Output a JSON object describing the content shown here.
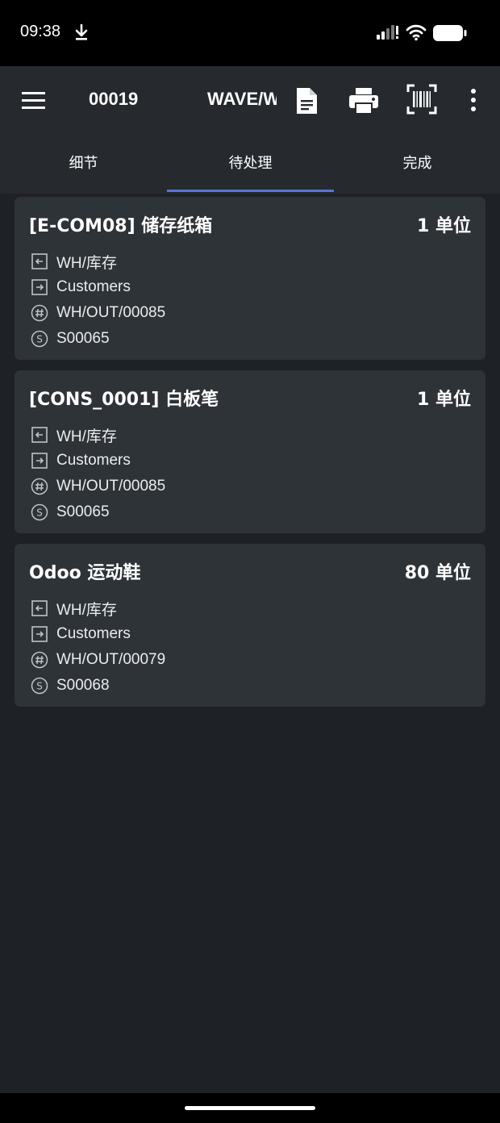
{
  "status": {
    "time": "09:38"
  },
  "header": {
    "title_id": "00019",
    "title_wave": "WAVE/W"
  },
  "tabs": [
    {
      "label": "细节"
    },
    {
      "label": "待处理"
    },
    {
      "label": "完成"
    }
  ],
  "active_tab": 1,
  "accent_color": "#5b75d6",
  "items": [
    {
      "name": "[E-COM08] 储存纸箱",
      "qty": "1 单位",
      "from": "WH/库存",
      "to": "Customers",
      "ref": "WH/OUT/00085",
      "origin": "S00065"
    },
    {
      "name": "[CONS_0001] 白板笔",
      "qty": "1 单位",
      "from": "WH/库存",
      "to": "Customers",
      "ref": "WH/OUT/00085",
      "origin": "S00065"
    },
    {
      "name": "Odoo 运动鞋",
      "qty": "80 单位",
      "from": "WH/库存",
      "to": "Customers",
      "ref": "WH/OUT/00079",
      "origin": "S00068"
    }
  ]
}
